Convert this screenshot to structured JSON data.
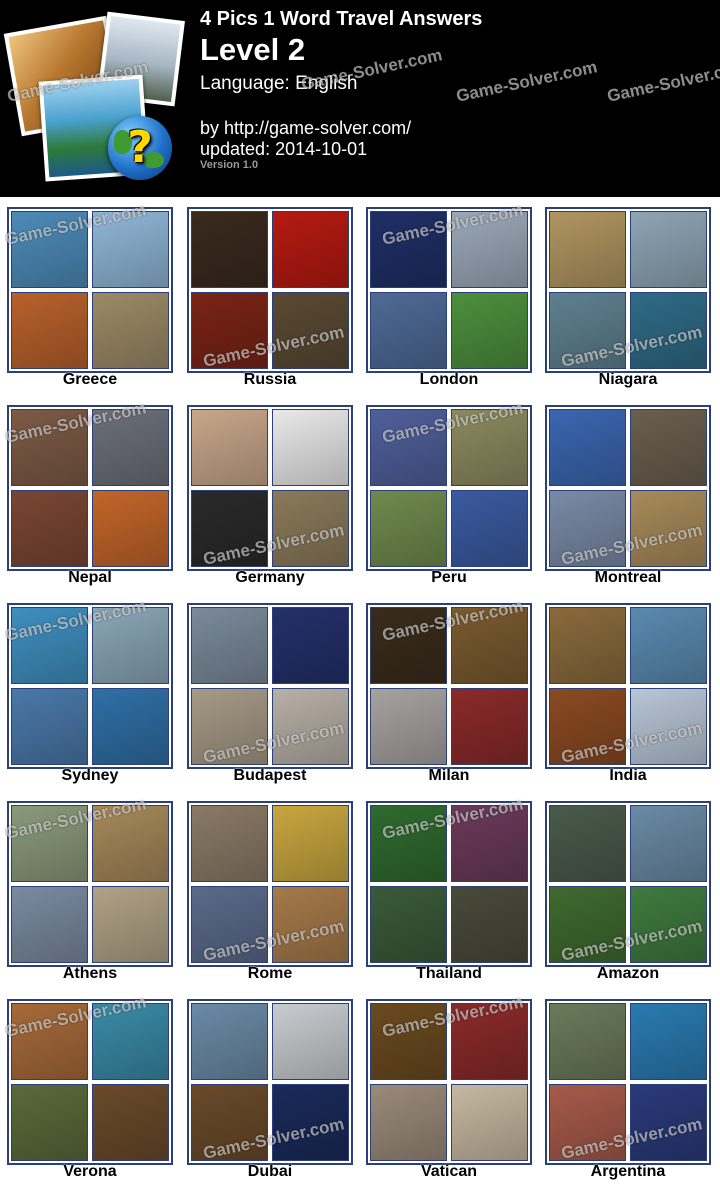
{
  "header": {
    "title": "4 Pics 1 Word Travel Answers",
    "level": "Level 2",
    "language": "Language: English",
    "by": "by http://game-solver.com/",
    "updated": "updated: 2014-10-01",
    "version": "Version 1.0",
    "watermark": "Game-Solver.com"
  },
  "logo": {
    "icon": "question-mark-globe-icon",
    "glyph": "?"
  },
  "puzzles": [
    {
      "answer": "Greece",
      "colors": [
        "#4d8bb8",
        "#8fb6d6",
        "#b8612c",
        "#9c8a66"
      ]
    },
    {
      "answer": "Russia",
      "colors": [
        "#3a2a1e",
        "#b51a12",
        "#7a2416",
        "#5a4a33"
      ]
    },
    {
      "answer": "London",
      "colors": [
        "#1f2f66",
        "#9aa8b8",
        "#4e6a96",
        "#4d8f3e"
      ]
    },
    {
      "answer": "Niagara",
      "colors": [
        "#b09560",
        "#8ea5b5",
        "#5f8090",
        "#2f6b86"
      ]
    },
    {
      "answer": "Nepal",
      "colors": [
        "#7d5a46",
        "#6b6f78",
        "#7a4634",
        "#c2652a"
      ]
    },
    {
      "answer": "Germany",
      "colors": [
        "#c8a68a",
        "#e9e9e9",
        "#2a2a2a",
        "#8a7a5a"
      ]
    },
    {
      "answer": "Peru",
      "colors": [
        "#4f5f9a",
        "#8c8a5f",
        "#6f8a4d",
        "#3a5aa0"
      ]
    },
    {
      "answer": "Montreal",
      "colors": [
        "#3b66b0",
        "#6a5f4f",
        "#7a8aa6",
        "#a88a5a"
      ]
    },
    {
      "answer": "Sydney",
      "colors": [
        "#3f8fbf",
        "#8aa6b6",
        "#4a78a8",
        "#2f6fa6"
      ]
    },
    {
      "answer": "Budapest",
      "colors": [
        "#7a8a9a",
        "#24306a",
        "#a69a86",
        "#b8b0a6"
      ]
    },
    {
      "answer": "Milan",
      "colors": [
        "#3a2c1c",
        "#7a5a2f",
        "#a6a2a0",
        "#8a2a2a"
      ]
    },
    {
      "answer": "India",
      "colors": [
        "#8a6a3c",
        "#5a8ab0",
        "#8a4a22",
        "#b8c6d6"
      ]
    },
    {
      "answer": "Athens",
      "colors": [
        "#8a9a7a",
        "#a6885a",
        "#7a8aa0",
        "#b0a286"
      ]
    },
    {
      "answer": "Rome",
      "colors": [
        "#8a7a66",
        "#c8a640",
        "#5a6a8a",
        "#a67a4a"
      ]
    },
    {
      "answer": "Thailand",
      "colors": [
        "#2f6a2f",
        "#6a3a5a",
        "#3a5a3a",
        "#4a4a3a"
      ]
    },
    {
      "answer": "Amazon",
      "colors": [
        "#4a5a4a",
        "#6a8aa6",
        "#3f6a2f",
        "#3f7a3f"
      ]
    },
    {
      "answer": "Verona",
      "colors": [
        "#a66a3a",
        "#3a8aa6",
        "#5a6a3a",
        "#6a4a2a"
      ]
    },
    {
      "answer": "Dubai",
      "colors": [
        "#6a8aa6",
        "#c8ccd0",
        "#6a4a2a",
        "#1a2a5a"
      ]
    },
    {
      "answer": "Vatican",
      "colors": [
        "#6a4a1f",
        "#8a2a2a",
        "#9a8a7a",
        "#c6b8a0"
      ]
    },
    {
      "answer": "Argentina",
      "colors": [
        "#6a7a5a",
        "#2a7ab0",
        "#a65a4a",
        "#2a3a7a"
      ]
    }
  ]
}
